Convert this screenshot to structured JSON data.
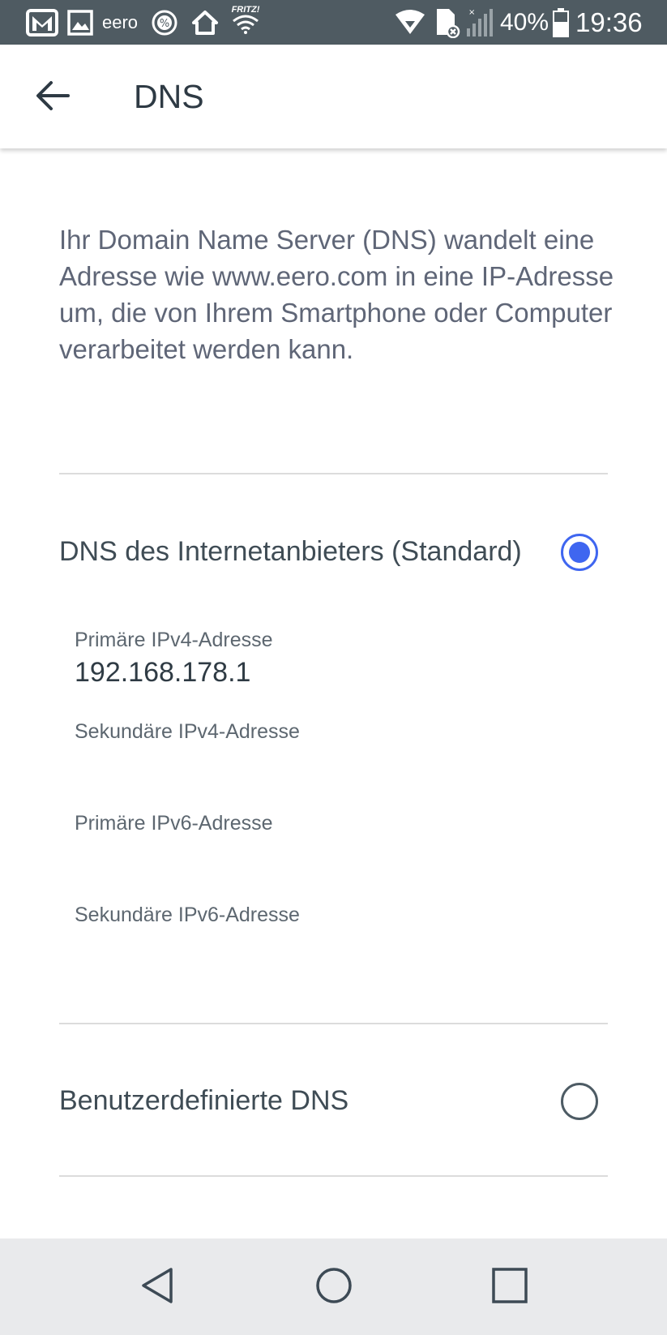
{
  "status_bar": {
    "carrier_label": "eero",
    "wifi_label": "FRITZ!",
    "battery_percent": "40%",
    "time": "19:36",
    "icons": [
      "gmail-icon",
      "gallery-icon",
      "eero-icon",
      "percent-icon",
      "home-icon",
      "fritz-wifi-icon",
      "wifi-icon",
      "data-icon",
      "signal-icon",
      "battery-icon"
    ]
  },
  "app_bar": {
    "back_icon": "arrow-back-icon",
    "title": "DNS"
  },
  "description": "Ihr Domain Name Server (DNS) wandelt eine Adresse wie www.eero.com in eine IP-Adresse um, die von Ihrem Smartphone oder Computer verarbeitet werden kann.",
  "options": {
    "isp": {
      "label": "DNS des Internetanbieters (Standard)",
      "selected": true
    },
    "custom": {
      "label": "Benutzerdefinierte DNS",
      "selected": false
    }
  },
  "fields": {
    "primary_ipv4": {
      "label": "Primäre IPv4-Adresse",
      "value": "192.168.178.1"
    },
    "secondary_ipv4": {
      "label": "Sekundäre IPv4-Adresse",
      "value": ""
    },
    "primary_ipv6": {
      "label": "Primäre IPv6-Adresse",
      "value": ""
    },
    "secondary_ipv6": {
      "label": "Sekundäre IPv6-Adresse",
      "value": ""
    }
  },
  "nav_bar": {
    "icons": [
      "nav-back-icon",
      "nav-home-icon",
      "nav-recents-icon"
    ]
  },
  "colors": {
    "status_bar_bg": "#4f5b62",
    "accent": "#3f66f0",
    "nav_bar_bg": "#e9eaec",
    "text_primary": "#3f4c55",
    "text_secondary": "#5f6677"
  }
}
